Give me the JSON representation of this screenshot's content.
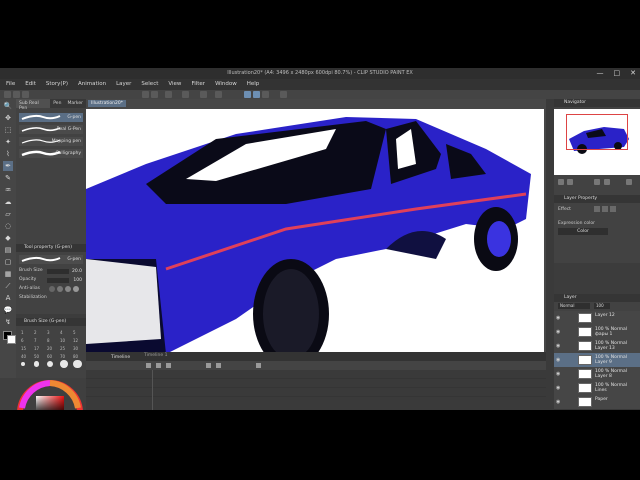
{
  "window": {
    "title": "Illustration20* (A4: 3496 x 2480px 600dpi 80.7%) - CLIP STUDIO PAINT EX",
    "controls": [
      "—",
      "□",
      "✕"
    ]
  },
  "menu": [
    "File",
    "Edit",
    "Story(P)",
    "Animation",
    "Layer",
    "Select",
    "View",
    "Filter",
    "Window",
    "Help"
  ],
  "subtool": {
    "tabs": [
      "Sub Real Pen",
      "Pen",
      "Marker"
    ],
    "brushes": [
      "G-pen",
      "Real G-Pen",
      "Mapping pen",
      "Calligraphy"
    ]
  },
  "tool_property": {
    "header": "Tool property (G-pen)",
    "brush_name": "G-pen",
    "rows": [
      {
        "label": "Brush Size",
        "value": "20.0"
      },
      {
        "label": "Opacity",
        "value": "100"
      },
      {
        "label": "Anti-alias",
        "value": ""
      },
      {
        "label": "Stabilization",
        "value": ""
      }
    ]
  },
  "brush_size": {
    "header": "Brush Size (G-pen)",
    "values": [
      "1",
      "2",
      "3",
      "4",
      "5",
      "6",
      "7",
      "8",
      "10",
      "12",
      "15",
      "17",
      "20",
      "25",
      "30",
      "40",
      "50",
      "60",
      "70",
      "80"
    ]
  },
  "canvas": {
    "doc_tab": "Illustration20*",
    "car_body_color": "#2a22c8",
    "stripe_color": "#e0405a"
  },
  "timeline": {
    "tab_label": "Timeline",
    "track_label": "Timeline 1"
  },
  "navigator": {
    "header": "Navigator"
  },
  "layer_property": {
    "header": "Layer Property",
    "effect_label": "Effect",
    "expression_label": "Expression color",
    "expression_value": "Color"
  },
  "layer_panel": {
    "header": "Layer",
    "blend_mode": "Normal",
    "opacity": "100",
    "layers": [
      {
        "line1": "Layer 12",
        "line2": ""
      },
      {
        "line1": "100 % Normal",
        "line2": "фары 1"
      },
      {
        "line1": "100 % Normal",
        "line2": "Layer 13"
      },
      {
        "line1": "100 % Normal",
        "line2": "Layer 9"
      },
      {
        "line1": "100 % Normal",
        "line2": "Layer 8"
      },
      {
        "line1": "100 % Normal",
        "line2": "Lines"
      },
      {
        "line1": "Paper",
        "line2": ""
      }
    ]
  }
}
